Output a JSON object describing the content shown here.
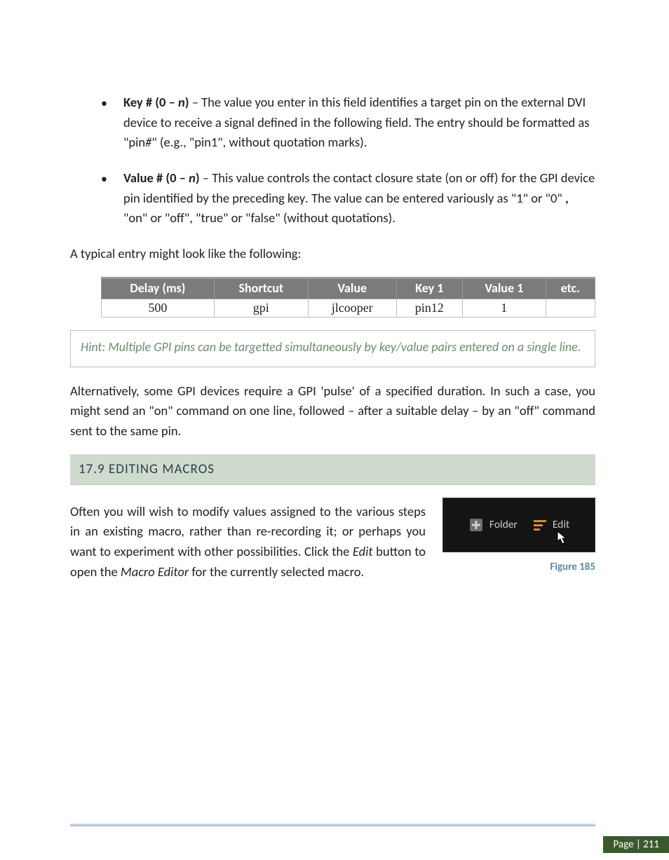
{
  "bullet1": {
    "lead_bold": "Key # (0 – ",
    "lead_italic_bold": "n",
    "lead_bold_close": ")",
    "rest": " – The value you enter in this field identifies a target pin on the external DVI device to receive a signal defined in the following field.  The entry should be formatted as \"pin",
    "pin_hash": "#",
    "rest2": "\" (e.g., \"pin1\", without quotation marks)."
  },
  "bullet2": {
    "lead_bold": "Value # (0 – ",
    "lead_italic_bold": "n",
    "lead_bold_close": ")",
    "rest": " – This value controls the contact closure state (on or off) for the GPI device pin identified by the preceding key",
    "period_italic": ".",
    "rest2": " The value can be entered variously as \"1\" or \"0\" ",
    "comma_bold": ",",
    "rest3": " \"on\" or \"off\", \"true\" or \"false\" (without quotations)."
  },
  "typical_intro": "A typical entry might look like the following:",
  "table": {
    "headers": [
      "Delay (ms)",
      "Shortcut",
      "Value",
      "Key 1",
      "Value 1",
      "etc."
    ],
    "row": [
      "500",
      "gpi",
      "jlcooper",
      "pin12",
      "1",
      ""
    ]
  },
  "hint": "Hint:  Multiple GPI pins can be targetted simultaneously by key/value pairs entered on a single line.",
  "alt_para": "Alternatively, some GPI devices require a GPI 'pulse' of a specified duration.  In such a case, you might send an \"on\" command on one line, followed – after a suitable delay – by an \"off\" command sent to the same pin.",
  "section_title": "17.9  EDITING MACROS",
  "editing_para": {
    "p1": "Often you will wish to modify values assigned to the various steps in an existing macro, rather than re-recording it; or perhaps you want to experiment with other possibilities. Click the ",
    "edit_word": "Edit",
    "p2": " button to open the ",
    "macro_editor": "Macro Editor",
    "p3": " for the currently selected macro."
  },
  "figbox": {
    "folder_label": "Folder",
    "edit_label": "Edit"
  },
  "figure_caption": "Figure 185",
  "page_number": "Page | 211"
}
